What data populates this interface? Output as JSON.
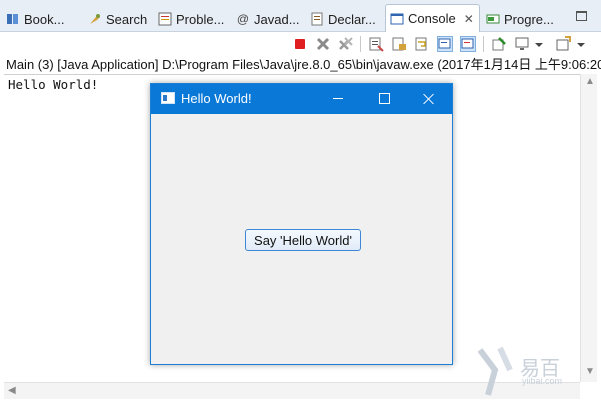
{
  "tabs": [
    {
      "label": "Book...",
      "icon": "bookmarks-icon"
    },
    {
      "label": "Search",
      "icon": "search-icon"
    },
    {
      "label": "Proble...",
      "icon": "problems-icon"
    },
    {
      "label": "Javad...",
      "icon": "javadoc-icon"
    },
    {
      "label": "Declar...",
      "icon": "declaration-icon"
    },
    {
      "label": "Console",
      "icon": "console-icon",
      "active": true,
      "close": "✕"
    },
    {
      "label": "Progre...",
      "icon": "progress-icon"
    }
  ],
  "status": {
    "text": "Main (3) [Java Application] D:\\Program Files\\Java\\jre.8.0_65\\bin\\javaw.exe (2017年1月14日 上午9:06:20"
  },
  "console": {
    "output": "Hello World!"
  },
  "dialog": {
    "title": "Hello World!",
    "button_label": "Say 'Hello World'"
  },
  "watermark": {
    "brand": "易百",
    "site": "yiibai.com"
  },
  "colors": {
    "accent": "#0a78d7",
    "tabbar": "#e8eef6",
    "terminate": "#e02020"
  }
}
